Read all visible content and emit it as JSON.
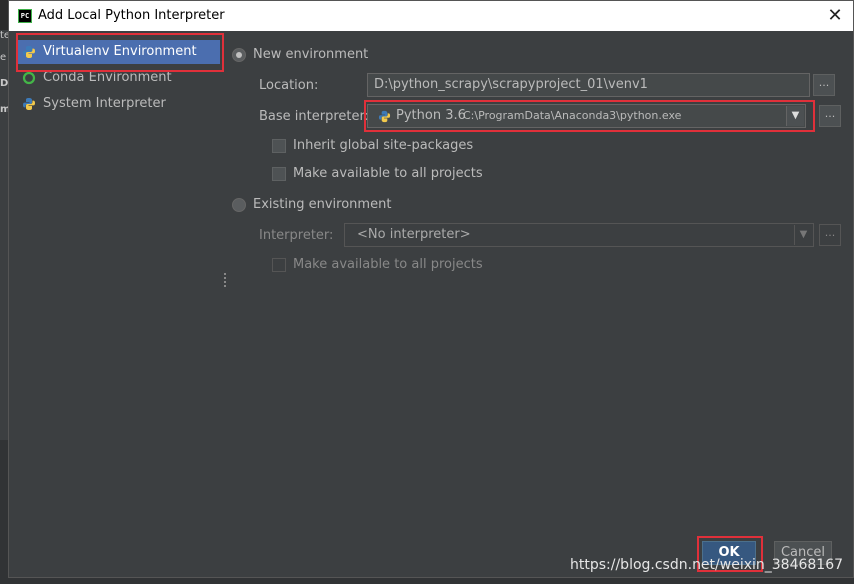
{
  "window": {
    "title": "Add Local Python Interpreter",
    "app_icon_text": "PC"
  },
  "background": {
    "left_chars": [
      "te",
      "e",
      "D",
      "m"
    ]
  },
  "sidebar": {
    "items": [
      {
        "label": "Virtualenv Environment",
        "icon": "python-venv-icon",
        "selected": true
      },
      {
        "label": "Conda Environment",
        "icon": "conda-ring-icon",
        "selected": false
      },
      {
        "label": "System Interpreter",
        "icon": "python-icon",
        "selected": false
      }
    ]
  },
  "new_env": {
    "radio_label": "New environment",
    "selected": true,
    "location_label": "Location:",
    "location_value": "D:\\python_scrapy\\scrapyproject_01\\venv1",
    "base_label": "Base interpreter:",
    "base_name": "Python 3.6",
    "base_path": "C:\\ProgramData\\Anaconda3\\python.exe",
    "inherit_label": "Inherit global site-packages",
    "make_available_label": "Make available to all projects",
    "browse_label": "..."
  },
  "existing_env": {
    "radio_label": "Existing environment",
    "selected": false,
    "interpreter_label": "Interpreter:",
    "interpreter_value": "<No interpreter>",
    "make_available_label": "Make available to all projects",
    "browse_label": "..."
  },
  "buttons": {
    "ok": "OK",
    "cancel": "Cancel"
  },
  "watermark": "https://blog.csdn.net/weixin_38468167",
  "colors": {
    "highlight": "#e0303a",
    "selection": "#4b6eaf",
    "dialog_bg": "#3c3f41",
    "primary_button": "#365880"
  }
}
